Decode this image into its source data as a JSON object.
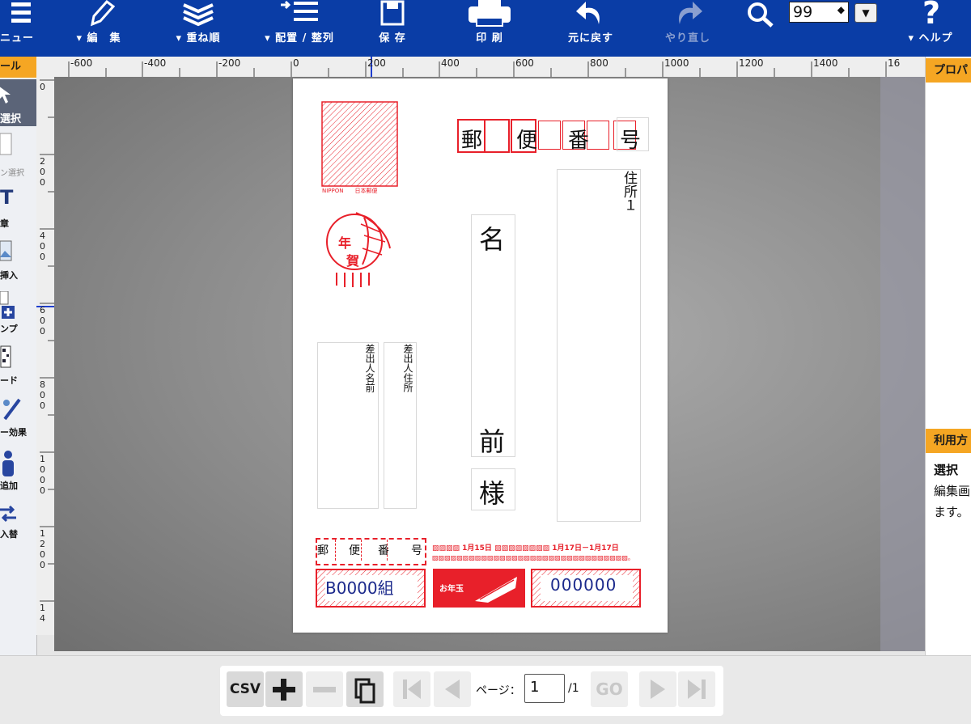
{
  "toolbar": {
    "menu": "ニュー",
    "edit": "▾ 編　集",
    "order": "▾ 重ね順",
    "arrange": "▾ 配置 / 整列",
    "save": "保 存",
    "print": "印 刷",
    "undo": "元に戻す",
    "redo": "やり直し",
    "zoom_value": "99",
    "help": "▾ ヘルプ"
  },
  "left_panel": {
    "header": "ール",
    "tools": [
      {
        "label": "選択"
      },
      {
        "label": "ン選択"
      },
      {
        "label": "章"
      },
      {
        "label": "挿入"
      },
      {
        "label": "ンプ"
      },
      {
        "label": "ード"
      },
      {
        "label": "ー効果"
      },
      {
        "label": "追加"
      },
      {
        "label": "入替"
      }
    ]
  },
  "ruler": {
    "h_labels": [
      "-600",
      "-400",
      "-200",
      "0",
      "200",
      "400",
      "600",
      "800",
      "1000",
      "1200",
      "1400",
      "16"
    ],
    "v_labels": [
      "0",
      "200",
      "400",
      "600",
      "800",
      "1000",
      "1200",
      "14"
    ]
  },
  "postcard": {
    "postal_chars": [
      "郵",
      "便",
      "番",
      "号"
    ],
    "recipient_address": "住所１",
    "recipient_name_top": "名",
    "recipient_name_bottom": "前",
    "honorific": "様",
    "sender_name": "差出人名前",
    "sender_address": "差出人住所",
    "sender_postal_chars": [
      "郵",
      "便",
      "番",
      "号"
    ],
    "nippon_label": "NIPPON　　日本郵便",
    "nenga_chars": [
      "年",
      "賀"
    ],
    "lottery_group": "B0000組",
    "lottery_number": "000000",
    "lottery_brand": "お年玉",
    "date_line1": "▨▨▨▨ 1月15日 ▨▨▨▨▨▨▨▨ 1月17日－1月17日",
    "date_line2": "▨▨▨▨▨▨▨▨▨▨▨▨▨▨▨▨▨▨▨▨▨▨▨▨▨▨▨▨▨▨▨▨。"
  },
  "right_panel": {
    "properties_header": "プロパ",
    "usage_header": "利用方",
    "usage_title": "選択",
    "usage_line1": "編集画",
    "usage_line2": "ます。"
  },
  "bottom_nav": {
    "csv": "CSV",
    "page_label": "ページ：",
    "page_value": "1",
    "page_total": "/1",
    "go": "GO"
  },
  "colors": {
    "toolbar_blue": "#0a3da6",
    "accent_orange": "#f5a623",
    "postmark_red": "#e8202a",
    "lottery_blue": "#1c2a8c"
  }
}
